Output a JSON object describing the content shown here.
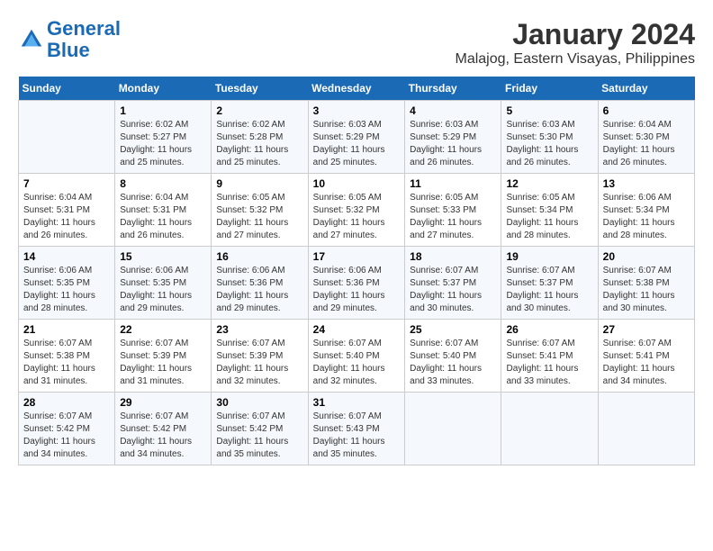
{
  "logo": {
    "line1": "General",
    "line2": "Blue"
  },
  "title": "January 2024",
  "subtitle": "Malajog, Eastern Visayas, Philippines",
  "headers": [
    "Sunday",
    "Monday",
    "Tuesday",
    "Wednesday",
    "Thursday",
    "Friday",
    "Saturday"
  ],
  "weeks": [
    [
      {
        "num": "",
        "sunrise": "",
        "sunset": "",
        "daylight": ""
      },
      {
        "num": "1",
        "sunrise": "Sunrise: 6:02 AM",
        "sunset": "Sunset: 5:27 PM",
        "daylight": "Daylight: 11 hours and 25 minutes."
      },
      {
        "num": "2",
        "sunrise": "Sunrise: 6:02 AM",
        "sunset": "Sunset: 5:28 PM",
        "daylight": "Daylight: 11 hours and 25 minutes."
      },
      {
        "num": "3",
        "sunrise": "Sunrise: 6:03 AM",
        "sunset": "Sunset: 5:29 PM",
        "daylight": "Daylight: 11 hours and 25 minutes."
      },
      {
        "num": "4",
        "sunrise": "Sunrise: 6:03 AM",
        "sunset": "Sunset: 5:29 PM",
        "daylight": "Daylight: 11 hours and 26 minutes."
      },
      {
        "num": "5",
        "sunrise": "Sunrise: 6:03 AM",
        "sunset": "Sunset: 5:30 PM",
        "daylight": "Daylight: 11 hours and 26 minutes."
      },
      {
        "num": "6",
        "sunrise": "Sunrise: 6:04 AM",
        "sunset": "Sunset: 5:30 PM",
        "daylight": "Daylight: 11 hours and 26 minutes."
      }
    ],
    [
      {
        "num": "7",
        "sunrise": "Sunrise: 6:04 AM",
        "sunset": "Sunset: 5:31 PM",
        "daylight": "Daylight: 11 hours and 26 minutes."
      },
      {
        "num": "8",
        "sunrise": "Sunrise: 6:04 AM",
        "sunset": "Sunset: 5:31 PM",
        "daylight": "Daylight: 11 hours and 26 minutes."
      },
      {
        "num": "9",
        "sunrise": "Sunrise: 6:05 AM",
        "sunset": "Sunset: 5:32 PM",
        "daylight": "Daylight: 11 hours and 27 minutes."
      },
      {
        "num": "10",
        "sunrise": "Sunrise: 6:05 AM",
        "sunset": "Sunset: 5:32 PM",
        "daylight": "Daylight: 11 hours and 27 minutes."
      },
      {
        "num": "11",
        "sunrise": "Sunrise: 6:05 AM",
        "sunset": "Sunset: 5:33 PM",
        "daylight": "Daylight: 11 hours and 27 minutes."
      },
      {
        "num": "12",
        "sunrise": "Sunrise: 6:05 AM",
        "sunset": "Sunset: 5:34 PM",
        "daylight": "Daylight: 11 hours and 28 minutes."
      },
      {
        "num": "13",
        "sunrise": "Sunrise: 6:06 AM",
        "sunset": "Sunset: 5:34 PM",
        "daylight": "Daylight: 11 hours and 28 minutes."
      }
    ],
    [
      {
        "num": "14",
        "sunrise": "Sunrise: 6:06 AM",
        "sunset": "Sunset: 5:35 PM",
        "daylight": "Daylight: 11 hours and 28 minutes."
      },
      {
        "num": "15",
        "sunrise": "Sunrise: 6:06 AM",
        "sunset": "Sunset: 5:35 PM",
        "daylight": "Daylight: 11 hours and 29 minutes."
      },
      {
        "num": "16",
        "sunrise": "Sunrise: 6:06 AM",
        "sunset": "Sunset: 5:36 PM",
        "daylight": "Daylight: 11 hours and 29 minutes."
      },
      {
        "num": "17",
        "sunrise": "Sunrise: 6:06 AM",
        "sunset": "Sunset: 5:36 PM",
        "daylight": "Daylight: 11 hours and 29 minutes."
      },
      {
        "num": "18",
        "sunrise": "Sunrise: 6:07 AM",
        "sunset": "Sunset: 5:37 PM",
        "daylight": "Daylight: 11 hours and 30 minutes."
      },
      {
        "num": "19",
        "sunrise": "Sunrise: 6:07 AM",
        "sunset": "Sunset: 5:37 PM",
        "daylight": "Daylight: 11 hours and 30 minutes."
      },
      {
        "num": "20",
        "sunrise": "Sunrise: 6:07 AM",
        "sunset": "Sunset: 5:38 PM",
        "daylight": "Daylight: 11 hours and 30 minutes."
      }
    ],
    [
      {
        "num": "21",
        "sunrise": "Sunrise: 6:07 AM",
        "sunset": "Sunset: 5:38 PM",
        "daylight": "Daylight: 11 hours and 31 minutes."
      },
      {
        "num": "22",
        "sunrise": "Sunrise: 6:07 AM",
        "sunset": "Sunset: 5:39 PM",
        "daylight": "Daylight: 11 hours and 31 minutes."
      },
      {
        "num": "23",
        "sunrise": "Sunrise: 6:07 AM",
        "sunset": "Sunset: 5:39 PM",
        "daylight": "Daylight: 11 hours and 32 minutes."
      },
      {
        "num": "24",
        "sunrise": "Sunrise: 6:07 AM",
        "sunset": "Sunset: 5:40 PM",
        "daylight": "Daylight: 11 hours and 32 minutes."
      },
      {
        "num": "25",
        "sunrise": "Sunrise: 6:07 AM",
        "sunset": "Sunset: 5:40 PM",
        "daylight": "Daylight: 11 hours and 33 minutes."
      },
      {
        "num": "26",
        "sunrise": "Sunrise: 6:07 AM",
        "sunset": "Sunset: 5:41 PM",
        "daylight": "Daylight: 11 hours and 33 minutes."
      },
      {
        "num": "27",
        "sunrise": "Sunrise: 6:07 AM",
        "sunset": "Sunset: 5:41 PM",
        "daylight": "Daylight: 11 hours and 34 minutes."
      }
    ],
    [
      {
        "num": "28",
        "sunrise": "Sunrise: 6:07 AM",
        "sunset": "Sunset: 5:42 PM",
        "daylight": "Daylight: 11 hours and 34 minutes."
      },
      {
        "num": "29",
        "sunrise": "Sunrise: 6:07 AM",
        "sunset": "Sunset: 5:42 PM",
        "daylight": "Daylight: 11 hours and 34 minutes."
      },
      {
        "num": "30",
        "sunrise": "Sunrise: 6:07 AM",
        "sunset": "Sunset: 5:42 PM",
        "daylight": "Daylight: 11 hours and 35 minutes."
      },
      {
        "num": "31",
        "sunrise": "Sunrise: 6:07 AM",
        "sunset": "Sunset: 5:43 PM",
        "daylight": "Daylight: 11 hours and 35 minutes."
      },
      {
        "num": "",
        "sunrise": "",
        "sunset": "",
        "daylight": ""
      },
      {
        "num": "",
        "sunrise": "",
        "sunset": "",
        "daylight": ""
      },
      {
        "num": "",
        "sunrise": "",
        "sunset": "",
        "daylight": ""
      }
    ]
  ]
}
